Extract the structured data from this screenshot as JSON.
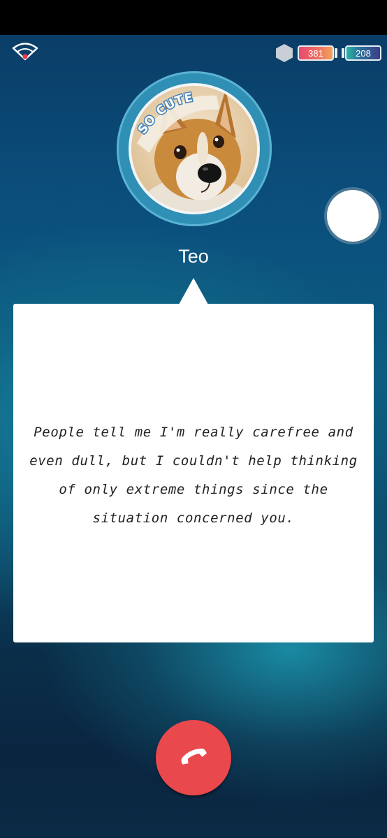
{
  "status": {
    "hearts": "381",
    "batteries": "208"
  },
  "icons": {
    "signal": "wifi-signal-icon",
    "hex": "hexagon-icon",
    "end_call": "phone-hangup-icon"
  },
  "avatar": {
    "sticker_text": "SO CUTE"
  },
  "caller": {
    "name": "Teo"
  },
  "message": {
    "text": "People tell me I'm really carefree and even dull, but I couldn't help thinking of only extreme things since the situation concerned you."
  },
  "colors": {
    "end_call": "#e9484d",
    "avatar_ring": "#2f8fb4",
    "bubble": "#ffffff"
  }
}
